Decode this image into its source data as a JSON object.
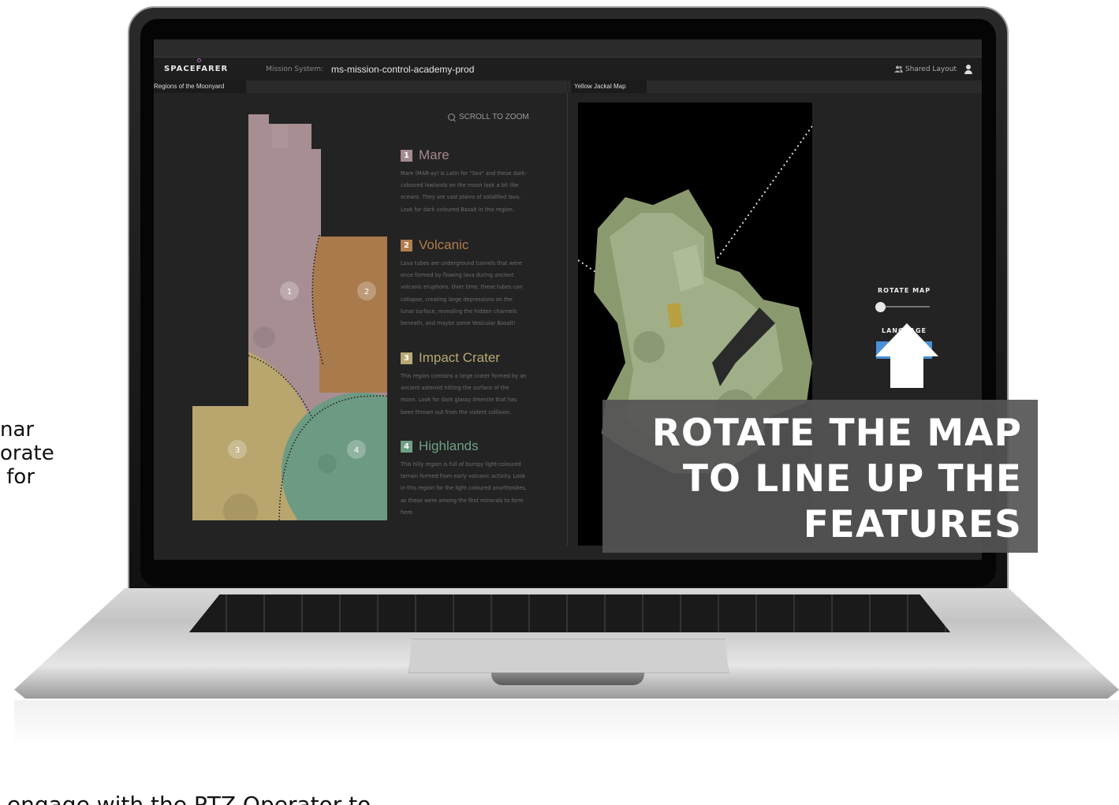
{
  "side_text": "nar\norate\n for",
  "bottom_text": " engage with the PTZ Operator to",
  "app": {
    "logo": "SPACEFARER",
    "mission_system_label": "Mission System:",
    "mission_system_value": "ms-mission-control-academy-prod",
    "shared_layout": "Shared Layout"
  },
  "left_panel": {
    "tab": "Regions of the Moonyard",
    "zoom_hint": "SCROLL TO ZOOM",
    "map_markers": [
      "1",
      "2",
      "3",
      "4"
    ],
    "regions": [
      {
        "number": "1",
        "title": "Mare",
        "color": "#a58a8f",
        "body": "Mare (MAR-ay) is Latin for \"Sea\" and these dark-coloured lowlands on the moon look a bit like oceans. They are vast plains of solidified lava. Look for dark coloured Basalt in this region."
      },
      {
        "number": "2",
        "title": "Volcanic",
        "color": "#b07d4c",
        "body": "Lava tubes are underground tunnels that were once formed by flowing lava during ancient volcanic eruptions. Over time, these tubes can collapse, creating large depressions on the lunar surface, revealing the hidden channels beneath, and maybe some Vesicular Basalt!"
      },
      {
        "number": "3",
        "title": "Impact Crater",
        "color": "#b8a873",
        "body": "This region contains a large crater formed by an ancient asteroid hitting the surface of the moon. Look for dark glassy Ilmenite that has been thrown out from the violent collision."
      },
      {
        "number": "4",
        "title": "Highlands",
        "color": "#6fa085",
        "body": "This hilly region is full of bumpy light-coloured terrain formed from early volcanic activity. Look in this region for the light coloured anorthosites, as these were among the first minerals to form here."
      }
    ]
  },
  "right_panel": {
    "tab": "Yellow Jackal Map",
    "rotate_label": "ROTATE MAP",
    "rotate_value": 0,
    "language_label": "LANGUAGE"
  },
  "callout": {
    "lines": [
      "ROTATE THE MAP",
      "TO LINE UP THE",
      "FEATURES"
    ]
  },
  "icons": [
    "search-icon",
    "users-icon",
    "user-icon",
    "arrow-up-icon"
  ]
}
